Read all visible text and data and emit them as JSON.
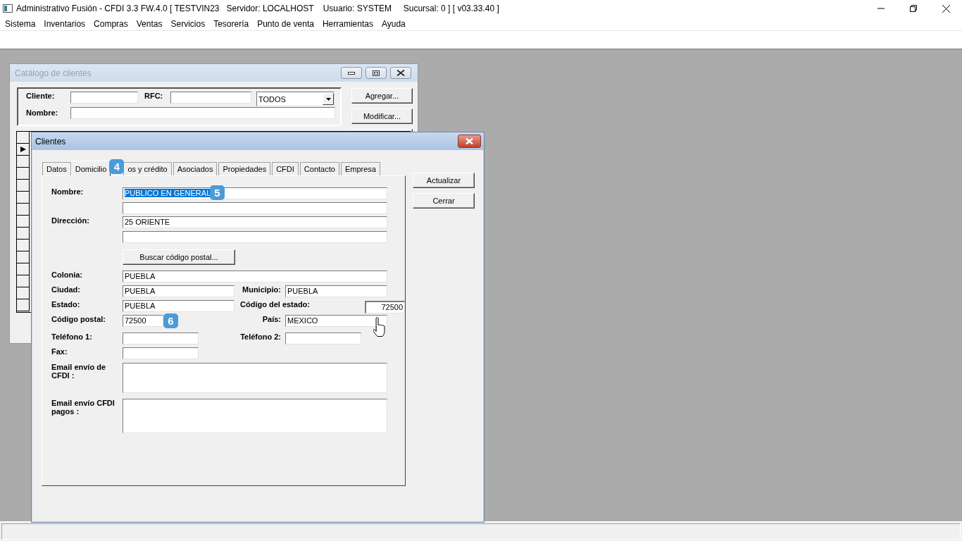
{
  "app_window": {
    "title": "Administrativo Fusión - CFDI 3.3 FW.4.0 [ TESTVIN23   Servidor: LOCALHOST    Usuario: SYSTEM     Sucursal: 0 ] [ v03.33.40 ]"
  },
  "menu": [
    "Sistema",
    "Inventarios",
    "Compras",
    "Ventas",
    "Servicios",
    "Tesorería",
    "Punto de venta",
    "Herramientas",
    "Ayuda"
  ],
  "catalog_window": {
    "title": "Catálogo de clientes",
    "cliente_label": "Cliente:",
    "rfc_label": "RFC:",
    "tipo_value": "TODOS",
    "nombre_label": "Nombre:",
    "buttons": [
      "Agregar...",
      "Modificar..."
    ],
    "grid_rows": [
      {
        "current": false
      },
      {
        "current": true
      },
      {
        "current": false
      },
      {
        "current": false
      },
      {
        "current": false
      },
      {
        "current": false
      },
      {
        "current": false
      },
      {
        "current": false
      },
      {
        "current": false
      },
      {
        "current": false
      },
      {
        "current": false
      },
      {
        "current": false
      },
      {
        "current": false
      },
      {
        "current": false
      },
      {
        "current": false
      }
    ]
  },
  "clientes_dialog": {
    "title": "Clientes",
    "tabs": [
      {
        "label": "Datos",
        "selected": false
      },
      {
        "label": "Domicilio",
        "selected": true,
        "step_badge": "4"
      },
      {
        "label": "os y crédito",
        "selected": false
      },
      {
        "label": "Asociados",
        "selected": false
      },
      {
        "label": "Propiedades",
        "selected": false
      },
      {
        "label": "CFDI",
        "selected": false
      },
      {
        "label": "Contacto",
        "selected": false
      },
      {
        "label": "Empresa",
        "selected": false
      }
    ],
    "buttons": [
      "Actualizar",
      "Cerrar"
    ],
    "form": {
      "nombre": {
        "label": "Nombre:",
        "value": "PUBLICO EN GENERAL",
        "value_selected": true,
        "step_badge": "5"
      },
      "direccion": {
        "label": "Dirección:",
        "value": "25 ORIENTE"
      },
      "buscar_button": "Buscar código postal...",
      "colonia": {
        "label": "Colonia:",
        "value": "PUEBLA"
      },
      "ciudad": {
        "label": "Ciudad:",
        "value": "PUEBLA"
      },
      "municipio": {
        "label": "Municipio:",
        "value": "PUEBLA"
      },
      "estado": {
        "label": "Estado:",
        "value": "PUEBLA"
      },
      "codigo_estado": {
        "label": "Código del estado:",
        "value": "72500"
      },
      "codigo_postal": {
        "label": "Código postal:",
        "value": "72500",
        "step_badge": "6"
      },
      "pais": {
        "label": "País:",
        "value": "MEXICO"
      },
      "telefono_1": {
        "label": "Teléfono 1:"
      },
      "telefono_2": {
        "label": "Teléfono 2:"
      },
      "fax": {
        "label": "Fax:"
      },
      "email_cfdi": {
        "label": "Email envío de CFDI :"
      },
      "email_pagos": {
        "label": "Email envío CFDI pagos :"
      }
    }
  }
}
